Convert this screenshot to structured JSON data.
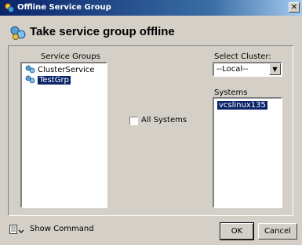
{
  "window": {
    "title": "Offline Service Group",
    "close_glyph": "✕"
  },
  "header": {
    "title": "Take service group offline",
    "icon": "service-group-icon"
  },
  "service_groups": {
    "label": "Service Groups",
    "items": [
      {
        "label": "ClusterService",
        "selected": false
      },
      {
        "label": "TestGrp",
        "selected": true
      }
    ]
  },
  "all_systems": {
    "label": "All Systems",
    "checked": false
  },
  "cluster": {
    "label": "Select Cluster:",
    "value": "--Local--"
  },
  "systems": {
    "label": "Systems",
    "items": [
      {
        "label": "vcslinux135",
        "selected": true
      }
    ]
  },
  "footer": {
    "show_command_label": "Show Command",
    "ok_label": "OK",
    "cancel_label": "Cancel"
  },
  "colors": {
    "selection": "#0a246a",
    "dialog_bg": "#d4d0c8",
    "titlebar": "#0a246a"
  }
}
